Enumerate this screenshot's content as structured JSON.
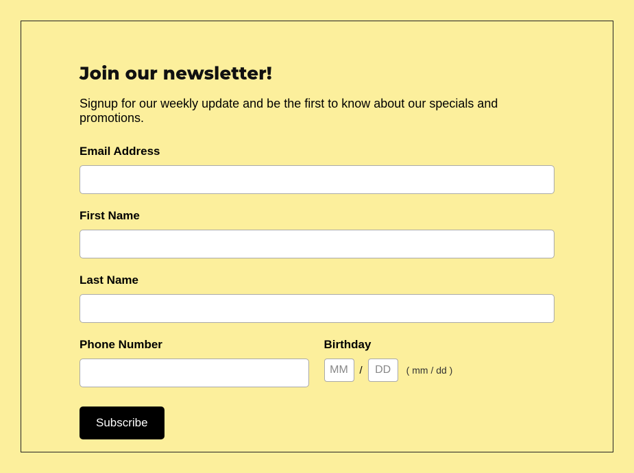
{
  "header": {
    "title": "Join our newsletter!",
    "subtitle": "Signup for our weekly update and be the first to know about our specials and promotions."
  },
  "fields": {
    "email": {
      "label": "Email Address",
      "value": ""
    },
    "first_name": {
      "label": "First Name",
      "value": ""
    },
    "last_name": {
      "label": "Last Name",
      "value": ""
    },
    "phone": {
      "label": "Phone Number",
      "value": ""
    },
    "birthday": {
      "label": "Birthday",
      "mm_placeholder": "MM",
      "dd_placeholder": "DD",
      "separator": "/",
      "hint": "( mm / dd )"
    }
  },
  "button": {
    "subscribe": "Subscribe"
  }
}
